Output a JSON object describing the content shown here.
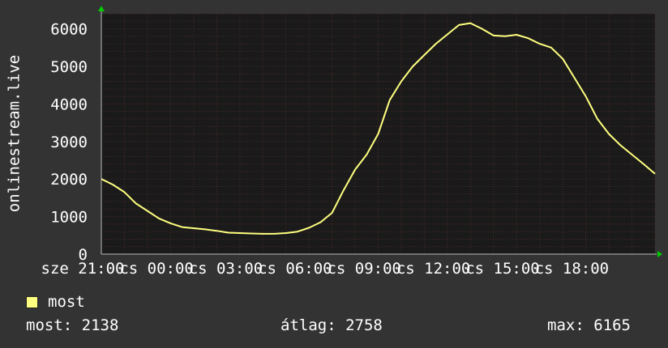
{
  "chart_data": {
    "type": "line",
    "ylabel": "onlinestream.live",
    "ylim": [
      0,
      6400
    ],
    "y_ticks": [
      0,
      1000,
      2000,
      3000,
      4000,
      5000,
      6000
    ],
    "x_tick_labels": [
      "sze 21:00",
      "cs 00:00",
      "cs 03:00",
      "cs 06:00",
      "cs 09:00",
      "cs 12:00",
      "cs 15:00",
      "cs 18:00"
    ],
    "grid": true,
    "colors": {
      "background": "#333333",
      "plot": "#1a1a1a",
      "grid": "#4a2a2a",
      "line": "#ffff80",
      "axis_arrow": "#00cc00"
    },
    "series": [
      {
        "name": "most",
        "x": [
          0,
          0.5,
          1,
          1.5,
          2,
          2.5,
          3,
          3.5,
          4,
          4.5,
          5,
          5.5,
          6,
          6.5,
          7,
          7.5,
          8,
          8.5,
          9,
          9.5,
          10,
          10.5,
          11,
          11.5,
          12,
          12.5,
          13,
          13.5,
          14,
          14.5,
          15,
          15.5,
          16,
          16.5,
          17,
          17.5,
          18,
          18.5,
          19,
          19.5,
          20,
          20.5,
          21,
          21.5,
          22,
          22.5,
          23,
          23.5,
          24
        ],
        "values": [
          2000,
          1850,
          1650,
          1350,
          1150,
          950,
          820,
          720,
          690,
          660,
          620,
          570,
          560,
          550,
          540,
          540,
          560,
          600,
          700,
          850,
          1100,
          1700,
          2250,
          2650,
          3200,
          4100,
          4600,
          5000,
          5300,
          5600,
          5850,
          6100,
          6150,
          6000,
          5820,
          5800,
          5840,
          5750,
          5600,
          5500,
          5200,
          4700,
          4200,
          3600,
          3200,
          2900,
          2650,
          2400,
          2138
        ]
      }
    ]
  },
  "legend": {
    "label": "most",
    "color": "#ffff80"
  },
  "stats": {
    "current": "most: 2138",
    "average": "átlag: 2758",
    "max": "max: 6165"
  }
}
